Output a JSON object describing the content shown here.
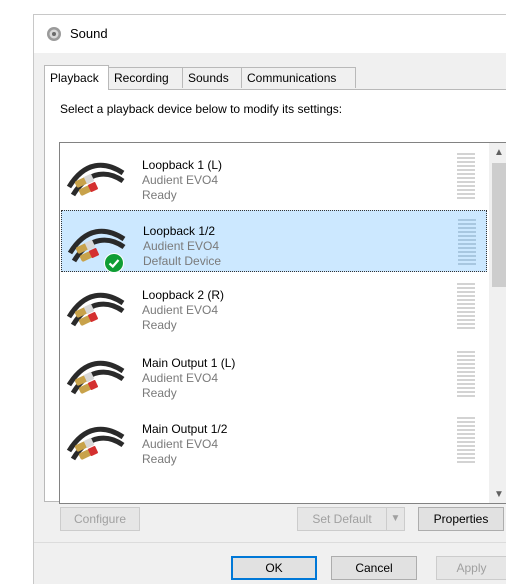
{
  "window": {
    "title": "Sound",
    "icon": "speaker-icon"
  },
  "tabs": [
    {
      "label": "Playback",
      "active": true
    },
    {
      "label": "Recording",
      "active": false
    },
    {
      "label": "Sounds",
      "active": false
    },
    {
      "label": "Communications",
      "active": false
    }
  ],
  "instruction": "Select a playback device below to modify its settings:",
  "devices": [
    {
      "name": "Loopback 1 (L)",
      "driver": "Audient EVO4",
      "status": "Ready",
      "selected": false,
      "default": false
    },
    {
      "name": "Loopback 1/2",
      "driver": "Audient EVO4",
      "status": "Default Device",
      "selected": true,
      "default": true
    },
    {
      "name": "Loopback 2 (R)",
      "driver": "Audient EVO4",
      "status": "Ready",
      "selected": false,
      "default": false
    },
    {
      "name": "Main Output 1 (L)",
      "driver": "Audient EVO4",
      "status": "Ready",
      "selected": false,
      "default": false
    },
    {
      "name": "Main Output 1/2",
      "driver": "Audient EVO4",
      "status": "Ready",
      "selected": false,
      "default": false
    }
  ],
  "buttons": {
    "configure": "Configure",
    "set_default": "Set Default",
    "properties": "Properties",
    "ok": "OK",
    "cancel": "Cancel",
    "apply": "Apply"
  },
  "icons": {
    "device": "rca-cable-icon",
    "default_badge": "check-icon",
    "scroll_up": "chevron-up-icon",
    "scroll_down": "chevron-down-icon",
    "dropdown": "chevron-down-icon"
  },
  "colors": {
    "selection": "#cce8ff",
    "default_check": "#0f9d34",
    "accent": "#0078d7"
  }
}
